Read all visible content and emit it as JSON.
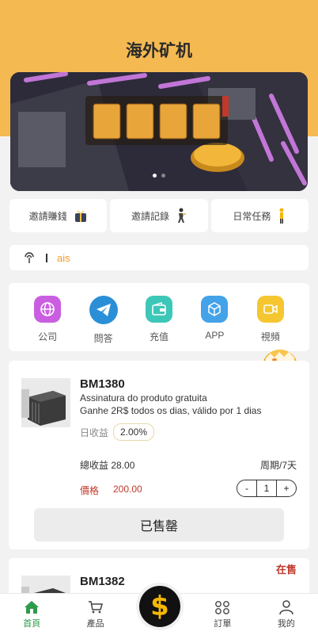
{
  "app": {
    "title": "海外矿机"
  },
  "banner": {
    "slides": 2,
    "active": 0
  },
  "quick_links": [
    {
      "label": "邀請賺錢",
      "icon": "gift-icon"
    },
    {
      "label": "邀請記錄",
      "icon": "person-icon"
    },
    {
      "label": "日常任務",
      "icon": "task-icon"
    }
  ],
  "notice": {
    "icon": "broadcast-icon",
    "text": "ais"
  },
  "menu": [
    {
      "label": "公司",
      "icon": "globe-icon",
      "color": "#c95fe0"
    },
    {
      "label": "問答",
      "icon": "telegram-icon",
      "color": "#2a8fd6"
    },
    {
      "label": "充值",
      "icon": "wallet-icon",
      "color": "#3dc7b8"
    },
    {
      "label": "APP",
      "icon": "cube-icon",
      "color": "#43a2e8"
    },
    {
      "label": "視頻",
      "icon": "video-icon",
      "color": "#f5c630"
    }
  ],
  "products": [
    {
      "name": "BM1380",
      "desc_line1": "Assinatura do produto gratuita",
      "desc_line2": "Ganhe 2R$ todos os dias, válido por 1 dias",
      "rate_label": "日收益",
      "rate": "2.00%",
      "total_label": "總收益",
      "total": "28.00",
      "period": "周期/7天",
      "price_label": "價格",
      "price": "200.00",
      "qty": "1",
      "minus": "-",
      "plus": "+",
      "button": "已售罄"
    },
    {
      "name": "BM1382",
      "status": "在售"
    }
  ],
  "tabbar": {
    "items": [
      {
        "label": "首頁",
        "icon": "home-icon",
        "active": true
      },
      {
        "label": "產品",
        "icon": "cart-icon",
        "active": false
      },
      {
        "label": "",
        "icon": "dollar-icon",
        "active": false
      },
      {
        "label": "訂單",
        "icon": "orders-icon",
        "active": false
      },
      {
        "label": "我的",
        "icon": "user-icon",
        "active": false
      }
    ],
    "center_symbol": "$"
  },
  "colors": {
    "header": "#f5b952",
    "active_tab": "#2e9b4a",
    "price": "#c0392b",
    "notice_text": "#f29a2e"
  }
}
